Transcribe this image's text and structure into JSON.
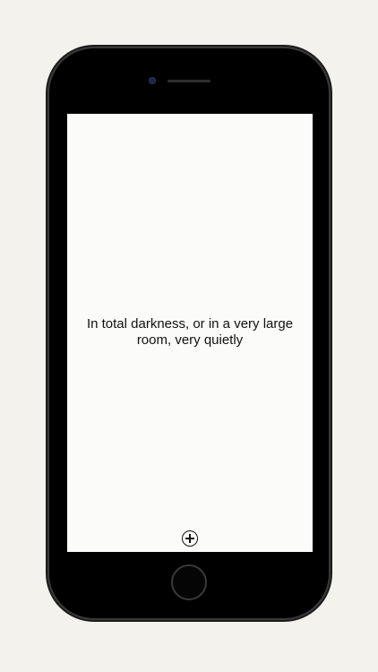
{
  "screen": {
    "message": "In total darkness, or in a very large room, very quietly"
  },
  "icons": {
    "add": "plus-circle-icon",
    "home": "home-button"
  },
  "colors": {
    "background": "#f4f2ed",
    "phone_body": "#000000",
    "screen": "#fbfbf9",
    "text": "#111111"
  }
}
